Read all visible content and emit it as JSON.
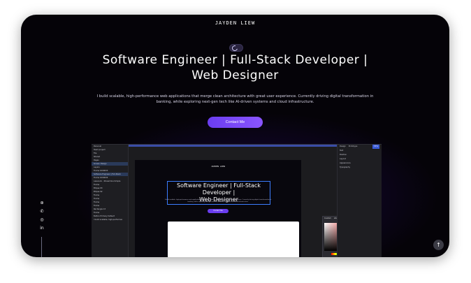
{
  "brand": "JAYDEN LIEW",
  "headline": {
    "line1": "Software Engineer | Full-Stack Developer |",
    "line2": "Web Designer"
  },
  "subtitle": {
    "line1": "I build scalable, high-performance web applications that merge clean architecture with great user experience. Currently driving digital transformation in",
    "line2": "banking, while exploring next-gen tech like AI-driven systems and cloud infrastructure."
  },
  "cta_label": "Contact Me",
  "social_icons": [
    "deviantart-icon",
    "whatsapp-icon",
    "instagram-icon",
    "linkedin-icon"
  ],
  "social_glyphs": [
    "⊛",
    "✆",
    "◎",
    "in"
  ],
  "scroll_top_glyph": "↑",
  "colors": {
    "background": "#050308",
    "accent": "#7a4af7",
    "glow": "#6e3cff"
  },
  "app_screenshot": {
    "left_panel": [
      "Personal",
      "Team project",
      "File",
      "Shared",
      "Pages",
      "Screen Design",
      "Layers",
      "Frame 1000033",
      "Software Engineer | Full-Stack",
      "Frame 1000034",
      "Lassoulin - Streamline Simple",
      "Frame",
      "Ellipse 93",
      "Ellipse 92",
      "Frame",
      "Frame",
      "Frame",
      "Frame",
      "Rectangle 13",
      "Frame",
      "Button Primary Default",
      "I build scalable, high-performan"
    ],
    "right_panel": {
      "tabs": [
        "Design",
        "Prototype"
      ],
      "zoom": "53%",
      "sections": [
        "Text",
        "Position",
        "Layout",
        "Appearance",
        "Typography"
      ]
    },
    "mini_brand": "JAYDEN LIEW",
    "mini_headline_1": "Software Engineer | Full-Stack Developer |",
    "mini_headline_2": "Web Designer",
    "mini_subtitle": "I build scalable, high-performance web applications that merge clean architecture with great user experience. Currently driving digital transformation in banking, while exploring next-gen tech like AI-driven systems and cloud infrastructure.",
    "mini_cta": "Contact Me",
    "picker_tabs": [
      "Custom",
      "Libraries"
    ]
  }
}
